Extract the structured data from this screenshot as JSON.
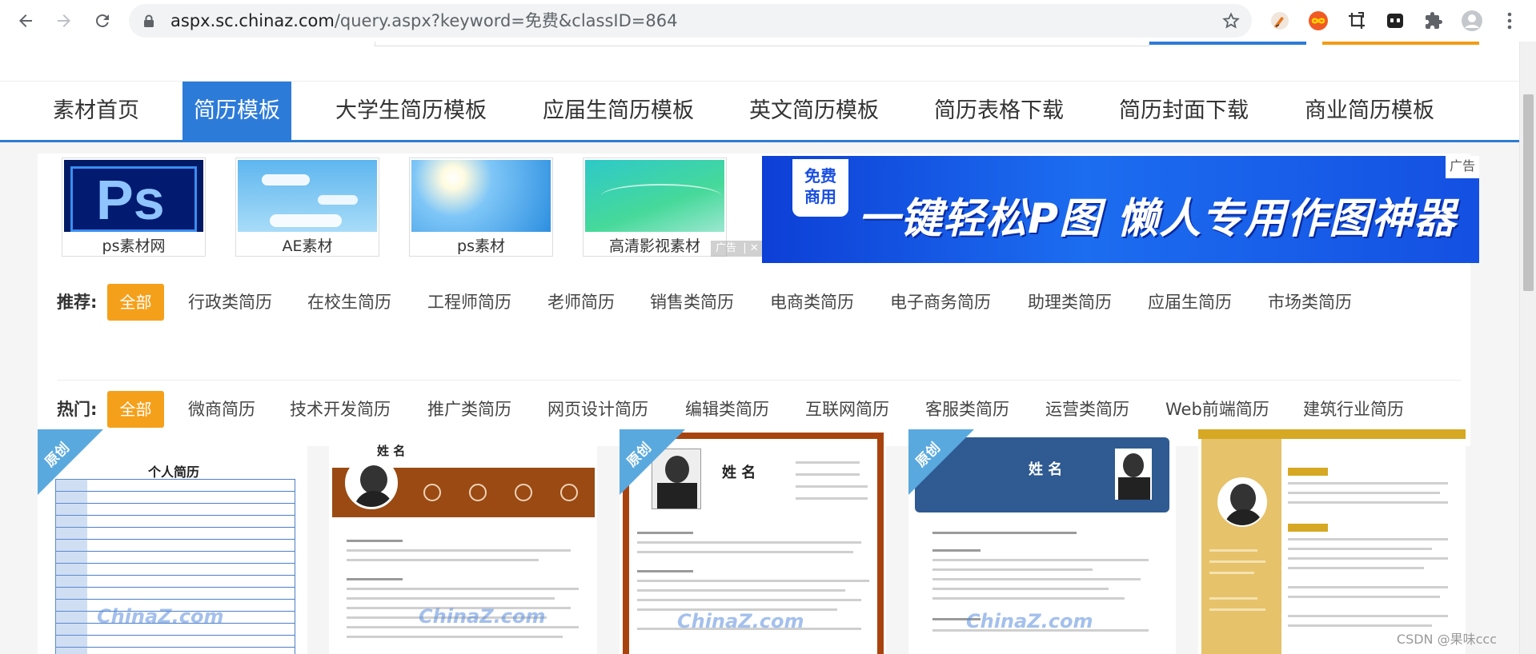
{
  "browser": {
    "url_host": "aspx.sc.chinaz.com",
    "url_path": "/query.aspx?keyword=免费&classID=864"
  },
  "nav": {
    "items": [
      {
        "label": "素材首页",
        "active": false
      },
      {
        "label": "简历模板",
        "active": true
      },
      {
        "label": "大学生简历模板",
        "active": false
      },
      {
        "label": "应届生简历模板",
        "active": false
      },
      {
        "label": "英文简历模板",
        "active": false
      },
      {
        "label": "简历表格下载",
        "active": false
      },
      {
        "label": "简历封面下载",
        "active": false
      },
      {
        "label": "商业简历模板",
        "active": false
      }
    ]
  },
  "quick_links": [
    {
      "label": "ps素材网"
    },
    {
      "label": "AE素材"
    },
    {
      "label": "ps素材"
    },
    {
      "label": "高清影视素材"
    }
  ],
  "ad": {
    "badge": "广告",
    "banner_tag": "免费\n商用",
    "banner_slogan": "一键轻松P图  懒人专用作图神器",
    "corner": "广告"
  },
  "recommend": {
    "label": "推荐:",
    "all": "全部",
    "options": [
      "行政类简历",
      "在校生简历",
      "工程师简历",
      "老师简历",
      "销售类简历",
      "电商类简历",
      "电子商务简历",
      "助理类简历",
      "应届生简历",
      "市场类简历"
    ]
  },
  "hot": {
    "label": "热门:",
    "all": "全部",
    "options": [
      "微商简历",
      "技术开发简历",
      "推广类简历",
      "网页设计简历",
      "编辑类简历",
      "互联网简历",
      "客服类简历",
      "运营类简历",
      "Web前端简历",
      "建筑行业简历"
    ]
  },
  "cards": {
    "ribbon": "原创",
    "watermark": "ChinaZ.com",
    "items": [
      {
        "title": "个人简历"
      },
      {
        "title": "姓 名"
      },
      {
        "title": "姓 名"
      },
      {
        "title": "姓 名"
      },
      {
        "title": ""
      }
    ]
  },
  "footer": {
    "credit": "CSDN @果味ccc"
  },
  "colors": {
    "accent": "#2d7bd8",
    "orange": "#f5a01a"
  }
}
